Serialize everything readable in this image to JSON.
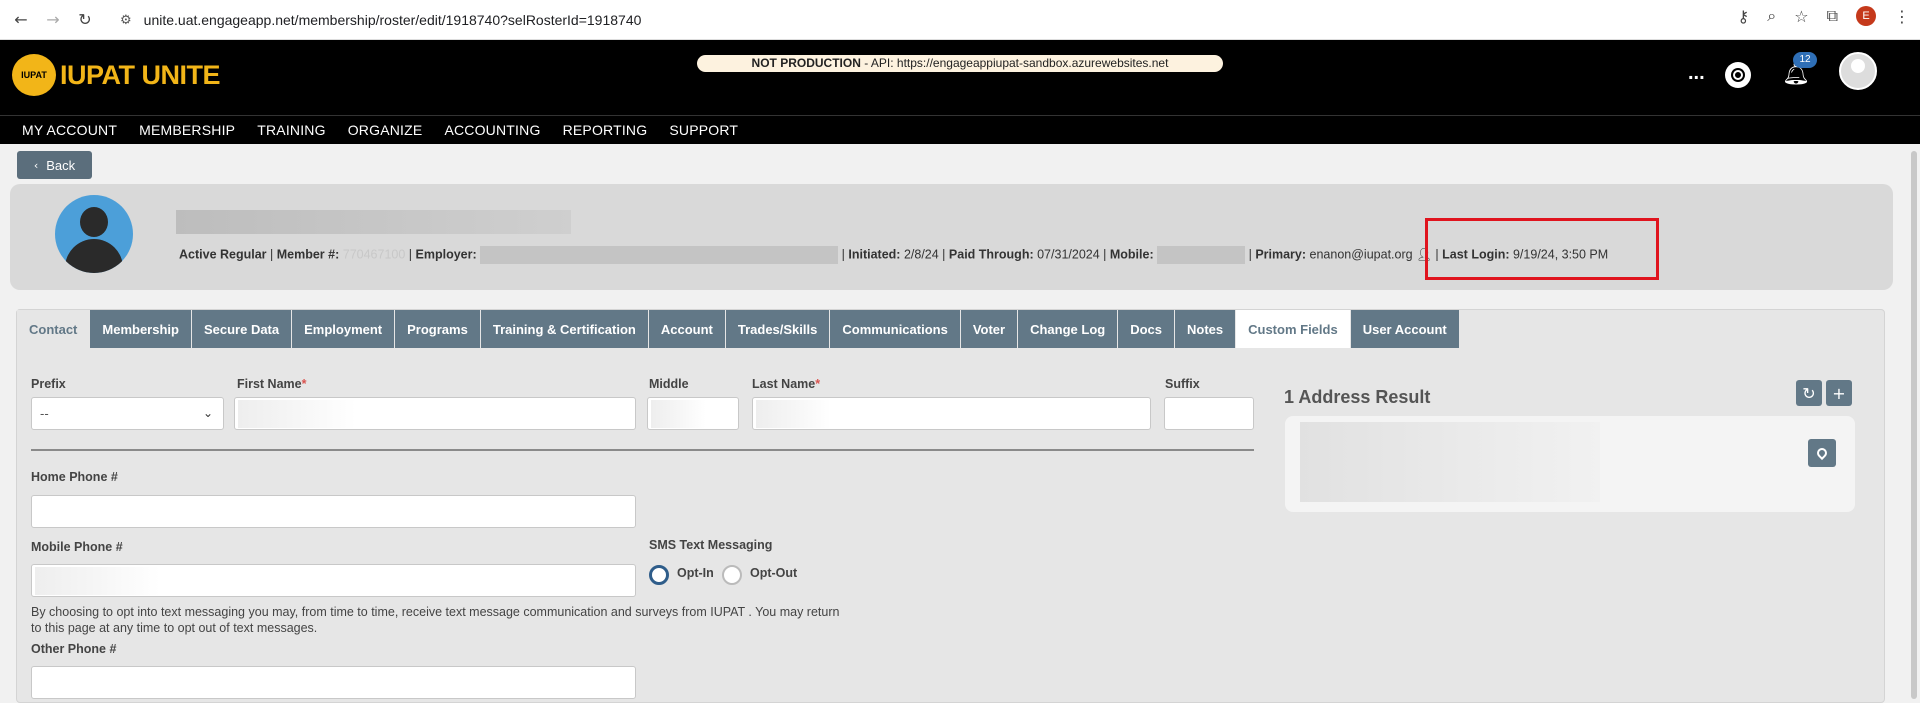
{
  "browser": {
    "url": "unite.uat.engageapp.net/membership/roster/edit/1918740?selRosterId=1918740",
    "profile_initial": "E"
  },
  "header": {
    "logo_text": "IUPAT UNITE",
    "logo_sub": "IUPAT",
    "banner_strong": "NOT PRODUCTION",
    "banner_rest": " - API: https://engageappiupat-sandbox.azurewebsites.net",
    "more": "...",
    "notification_count": "12"
  },
  "menu": [
    "MY ACCOUNT",
    "MEMBERSHIP",
    "TRAINING",
    "ORGANIZE",
    "ACCOUNTING",
    "REPORTING",
    "SUPPORT"
  ],
  "back_label": "Back",
  "profile": {
    "status": "Active Regular",
    "member_label": "Member #:",
    "member_partial": "770467100",
    "employer_label": "Employer:",
    "initiated_label": "Initiated:",
    "initiated": "2/8/24",
    "paid_label": "Paid Through:",
    "paid": "07/31/2024",
    "mobile_label": "Mobile:",
    "primary_label": "Primary:",
    "primary": "enanon@iupat.org",
    "last_login_label": "Last Login:",
    "last_login": "9/19/24, 3:50 PM"
  },
  "tabs": [
    "Contact",
    "Membership",
    "Secure Data",
    "Employment",
    "Programs",
    "Training & Certification",
    "Account",
    "Trades/Skills",
    "Communications",
    "Voter",
    "Change Log",
    "Docs",
    "Notes",
    "Custom Fields",
    "User Account"
  ],
  "form": {
    "prefix_label": "Prefix",
    "prefix_value": "--",
    "first_name_label": "First Name",
    "middle_label": "Middle",
    "last_name_label": "Last Name",
    "suffix_label": "Suffix",
    "required_mark": "*",
    "home_phone_label": "Home Phone #",
    "mobile_phone_label": "Mobile Phone #",
    "sms_label": "SMS Text Messaging",
    "opt_in": "Opt-In",
    "opt_out": "Opt-Out",
    "sms_selected": "Opt-In",
    "sms_note": "By choosing to opt into text messaging you may, from time to time, receive text message communication and surveys from IUPAT . You may return to this page at any time to opt out of text messages.",
    "other_phone_label": "Other Phone #"
  },
  "address": {
    "title": "1 Address Result"
  }
}
